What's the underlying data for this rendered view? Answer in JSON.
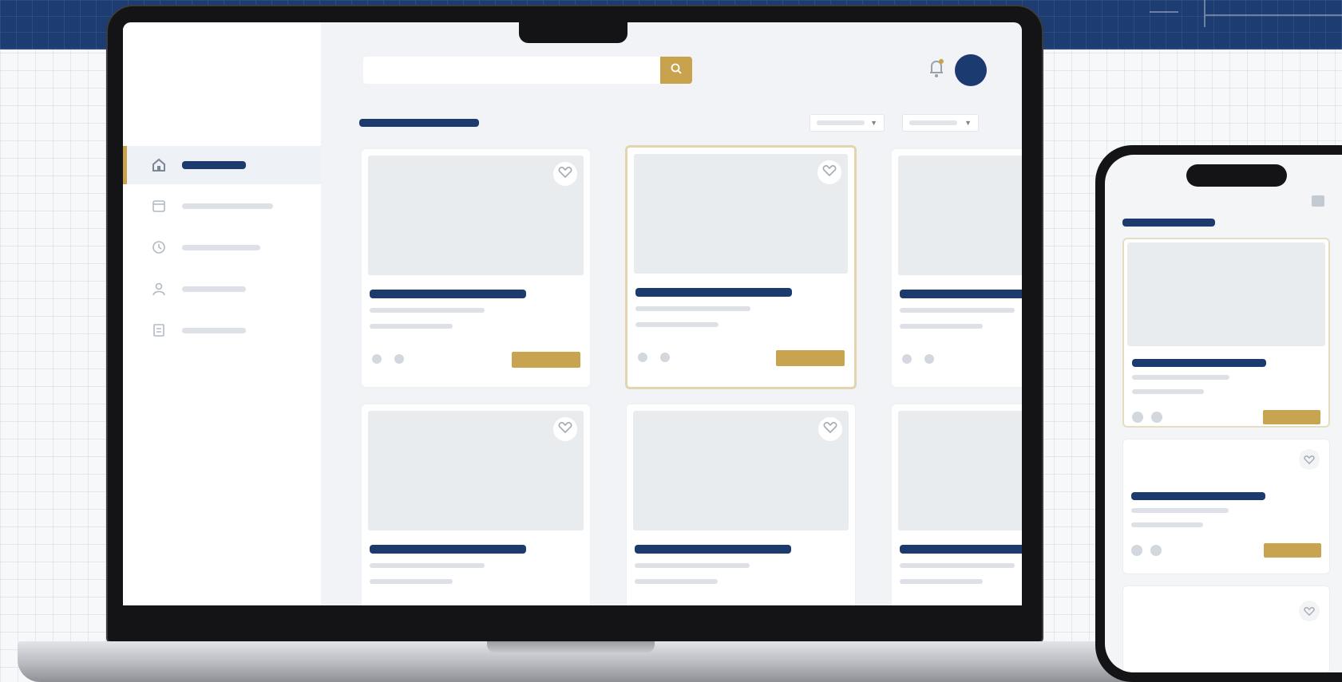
{
  "app": {
    "search": {
      "placeholder": ""
    },
    "sidebar": {
      "items": [
        {
          "label": "",
          "icon": "home-icon",
          "active": true
        },
        {
          "label": "",
          "icon": "calendar-icon",
          "active": false
        },
        {
          "label": "",
          "icon": "clock-icon",
          "active": false
        },
        {
          "label": "",
          "icon": "user-icon",
          "active": false
        },
        {
          "label": "",
          "icon": "document-icon",
          "active": false
        }
      ]
    },
    "header": {
      "section_title": "",
      "filters": [
        {
          "label": "",
          "icon": "chevron-down-icon"
        },
        {
          "label": "",
          "icon": "chevron-down-icon"
        }
      ],
      "notification_icon": "bell-icon",
      "avatar": "avatar"
    },
    "cards": [
      {
        "title": "",
        "highlighted": false
      },
      {
        "title": "",
        "highlighted": true
      },
      {
        "title": "",
        "highlighted": false
      },
      {
        "title": "",
        "highlighted": false
      },
      {
        "title": "",
        "highlighted": false
      },
      {
        "title": "",
        "highlighted": false
      }
    ],
    "mobile": {
      "menu_icon": "hamburger-icon",
      "section_title": "",
      "cards": [
        {
          "title": "",
          "highlighted": true
        },
        {
          "title": "",
          "highlighted": false
        },
        {
          "title": "",
          "highlighted": false
        }
      ]
    }
  },
  "colors": {
    "primary_navy": "#1d3a6e",
    "accent_gold": "#c8a24c",
    "blueprint": "#1c3c72",
    "placeholder_grey": "#e9ecef"
  }
}
